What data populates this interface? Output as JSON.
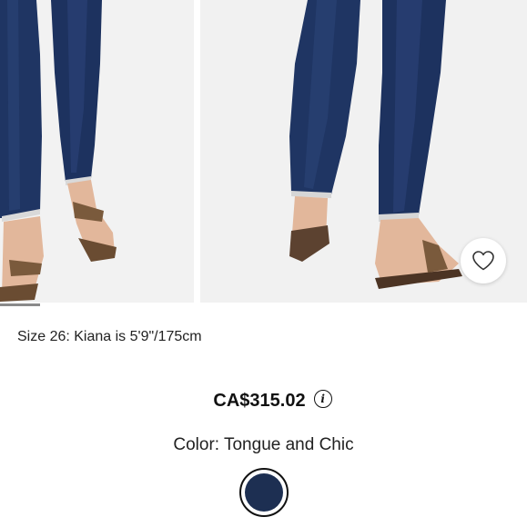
{
  "product": {
    "size_note": "Size 26: Kiana is 5'9\"/175cm",
    "price": "CA$315.02",
    "color_label": "Color: Tongue and Chic",
    "selected_color_hex": "#1d2f52"
  },
  "gallery": {
    "background": "#f1f1f1",
    "denim_color": "#1f3563",
    "sandal_color": "#7a5a3c",
    "skin_color": "#e2b79b"
  },
  "icons": {
    "favorite": "heart-outline-icon",
    "info": "info-circle-icon"
  }
}
